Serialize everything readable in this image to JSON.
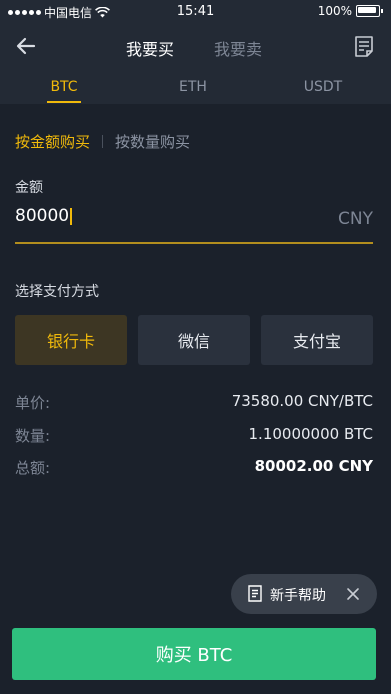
{
  "status_bar": {
    "carrier": "中国电信",
    "time": "15:41",
    "battery": "100%"
  },
  "nav": {
    "back_icon": "back-arrow-icon",
    "tab_buy": "我要买",
    "tab_sell": "我要卖",
    "orders_icon": "orders-document-icon"
  },
  "coins": {
    "tabs": [
      "BTC",
      "ETH",
      "USDT"
    ],
    "active": "BTC"
  },
  "mode": {
    "by_amount": "按金额购买",
    "by_quantity": "按数量购买",
    "active": "by_amount"
  },
  "amount": {
    "label": "金额",
    "value": "80000",
    "unit": "CNY"
  },
  "payment": {
    "label": "选择支付方式",
    "methods": [
      "银行卡",
      "微信",
      "支付宝"
    ],
    "selected": "银行卡"
  },
  "summary": {
    "price_label": "单价:",
    "price_value": "73580.00 CNY/BTC",
    "quantity_label": "数量:",
    "quantity_value": "1.10000000 BTC",
    "total_label": "总额:",
    "total_value": "80002.00 CNY"
  },
  "help": {
    "label": "新手帮助",
    "doc_icon": "help-document-icon",
    "close_icon": "close-icon"
  },
  "buy_button": {
    "label": "购买 BTC"
  },
  "colors": {
    "background": "#1b212b",
    "header": "#232a35",
    "accent": "#f0b90b",
    "buy_green": "#2fbf7e"
  }
}
